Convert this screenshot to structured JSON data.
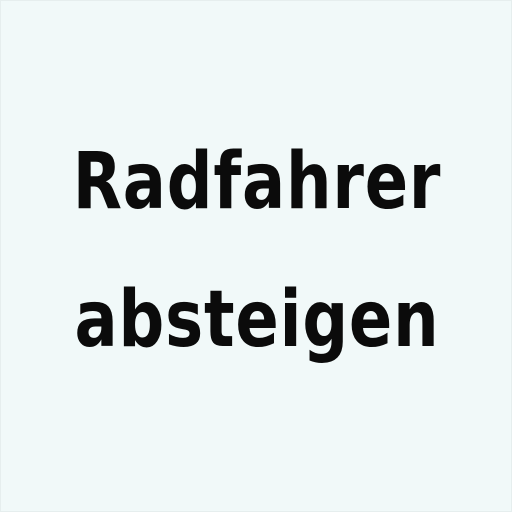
{
  "sign": {
    "lines": [
      "Radfahrer",
      "absteigen"
    ],
    "background_color": "#f1f9f9",
    "text_color": "#0b0b0b"
  }
}
